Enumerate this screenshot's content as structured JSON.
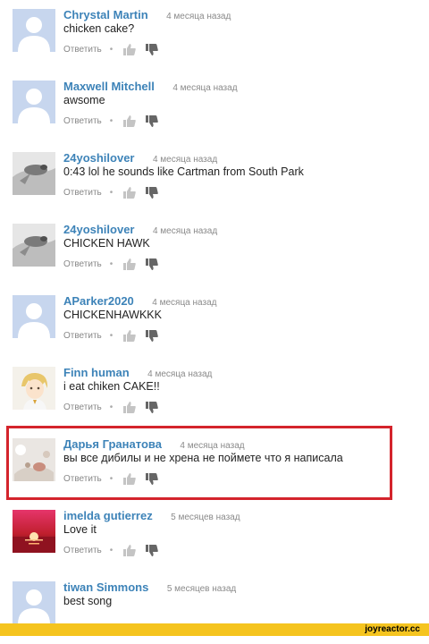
{
  "comments": [
    {
      "author": "Chrystal Martin",
      "time": "4 месяца назад",
      "text": "chicken cake?",
      "reply_label": "Ответить",
      "avatar": "default-avatar",
      "show_actions": true
    },
    {
      "author": "Maxwell Mitchell",
      "time": "4 месяца назад",
      "text": "awsome",
      "reply_label": "Ответить",
      "avatar": "default-avatar",
      "show_actions": true
    },
    {
      "author": "24yoshilover",
      "time": "4 месяца назад",
      "text": "0:43 lol he sounds like Cartman from South Park",
      "reply_label": "Ответить",
      "avatar": "bird-avatar",
      "show_actions": true
    },
    {
      "author": "24yoshilover",
      "time": "4 месяца назад",
      "text": "CHICKEN HAWK",
      "reply_label": "Ответить",
      "avatar": "bird-avatar",
      "show_actions": true
    },
    {
      "author": "AParker2020",
      "time": "4 месяца назад",
      "text": "CHICKENHAWKKK",
      "reply_label": "Ответить",
      "avatar": "default-avatar",
      "show_actions": true
    },
    {
      "author": "Finn human",
      "time": "4 месяца назад",
      "text": "i eat chiken CAKE!!",
      "reply_label": "Ответить",
      "avatar": "anime-avatar",
      "show_actions": true
    },
    {
      "author": "Дарья Гранатова",
      "time": "4 месяца назад",
      "text": "вы все дибилы и не хрена не поймете что я написала",
      "reply_label": "Ответить",
      "avatar": "photo-avatar",
      "show_actions": true
    },
    {
      "author": "imelda gutierrez",
      "time": "5 месяцев назад",
      "text": "Love it",
      "reply_label": "Ответить",
      "avatar": "sunset-avatar",
      "show_actions": true
    },
    {
      "author": "tiwan Simmons",
      "time": "5 месяцев назад",
      "text": "best song",
      "reply_label": "Ответить",
      "avatar": "default-avatar",
      "show_actions": false
    }
  ],
  "watermark": "joyreactor.cc",
  "colors": {
    "author_link": "#3d83b8",
    "highlight_border": "#d4242c",
    "footer_bar": "#f5c41f"
  }
}
